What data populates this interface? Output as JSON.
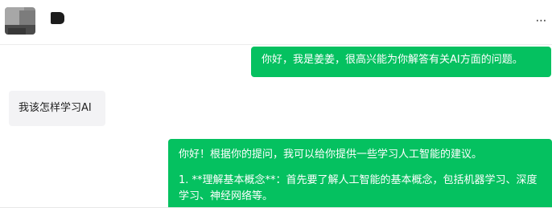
{
  "header": {
    "more_label": "⋯"
  },
  "messages": [
    {
      "role": "assistant",
      "paragraphs": [
        "你好，我是姜姜，很高兴能为你解答有关AI方面的问题。"
      ]
    },
    {
      "role": "user",
      "paragraphs": [
        "我该怎样学习AI"
      ]
    },
    {
      "role": "assistant",
      "paragraphs": [
        "你好！根据你的提问，我可以给你提供一些学习人工智能的建议。",
        "1. **理解基本概念**：首先要了解人工智能的基本概念，包括机器学习、深度学习、神经网络等。"
      ]
    }
  ],
  "colors": {
    "assistant_bubble": "#05c160",
    "user_bubble": "#f3f3f5",
    "header_border": "#ececec"
  }
}
